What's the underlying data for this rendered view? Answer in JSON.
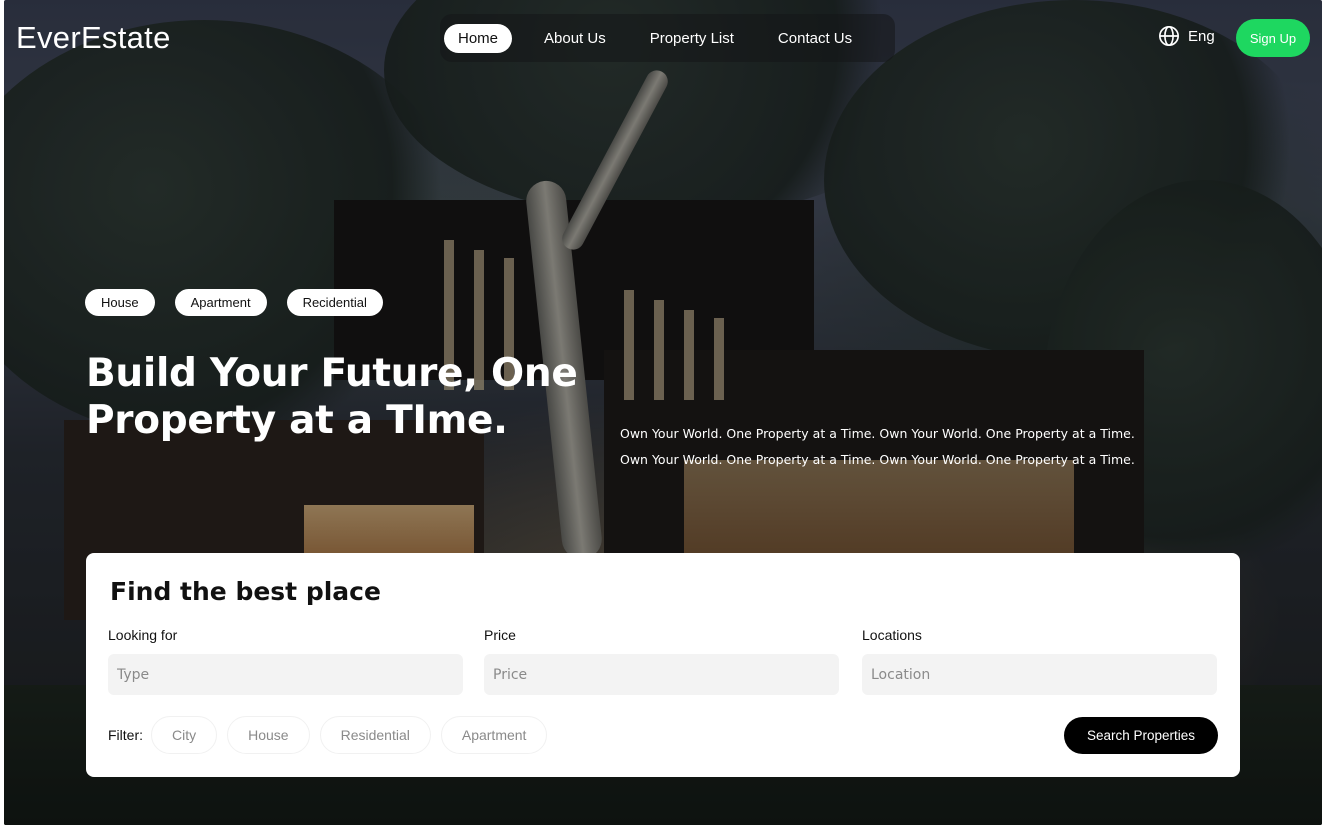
{
  "header": {
    "logo": "EverEstate",
    "nav": [
      "Home",
      "About Us",
      "Property List",
      "Contact Us"
    ],
    "active_nav": "Home",
    "language": "Eng",
    "signup_label": "Sign Up",
    "signup_color": "#1ed760"
  },
  "hero": {
    "tags": [
      "House",
      "Apartment",
      "Recidential"
    ],
    "headline": "Build Your Future, One Property at a TIme.",
    "tagline_line1": "Own Your World. One Property at a Time. Own Your World. One Property at a Time.",
    "tagline_line2": "Own Your World. One Property at a Time. Own Your World. One Property at a Time."
  },
  "search": {
    "title": "Find the best place",
    "fields": [
      {
        "label": "Looking for",
        "placeholder": "Type"
      },
      {
        "label": "Price",
        "placeholder": "Price"
      },
      {
        "label": "Locations",
        "placeholder": "Location"
      }
    ],
    "filter_label": "Filter:",
    "filters": [
      "City",
      "House",
      "Residential",
      "Apartment"
    ],
    "button_label": "Search Properties"
  },
  "icons": {
    "globe": "globe-icon"
  }
}
